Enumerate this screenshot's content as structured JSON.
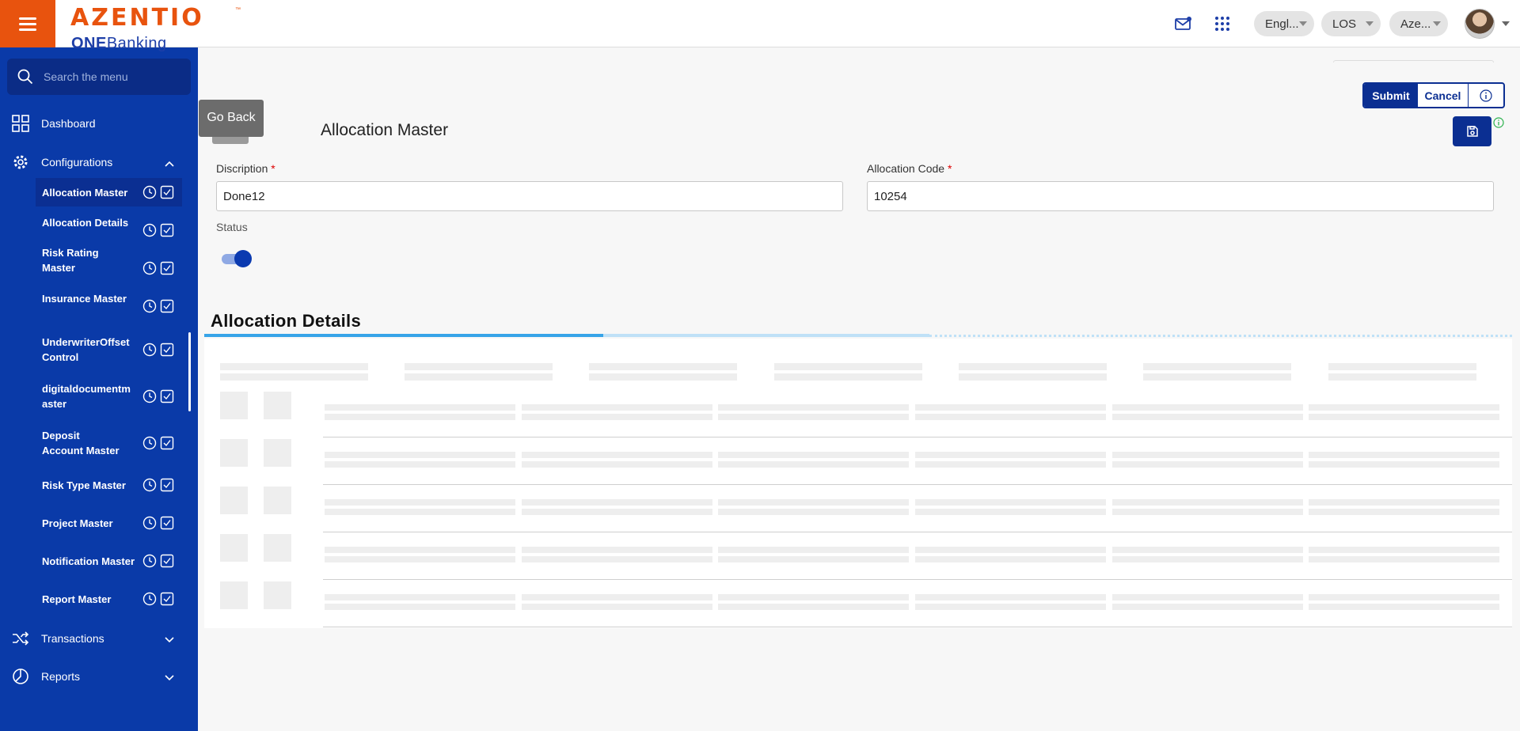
{
  "brand": {
    "name": "AZENTIO",
    "tm": "™",
    "sub_bold": "ONE",
    "sub_rest": "Banking"
  },
  "header": {
    "language": "Engl...",
    "module": "LOS",
    "entity": "Aze..."
  },
  "sidebar": {
    "search_placeholder": "Search the menu",
    "dashboard": "Dashboard",
    "configurations": "Configurations",
    "items": [
      {
        "label": "Allocation Master"
      },
      {
        "label": "Allocation Details"
      },
      {
        "label": "Risk Rating Master"
      },
      {
        "label": "Insurance Master"
      },
      {
        "label": "UnderwriterOffsetControl"
      },
      {
        "label": "digitaldocumentmaster"
      },
      {
        "label": "Deposit Account Master"
      },
      {
        "label": "Risk Type Master"
      },
      {
        "label": "Project Master"
      },
      {
        "label": "Notification Master"
      },
      {
        "label": "Report Master"
      }
    ],
    "transactions": "Transactions",
    "reports": "Reports"
  },
  "page": {
    "go_back": "Go Back",
    "title": "Allocation Master",
    "submit": "Submit",
    "cancel": "Cancel"
  },
  "form": {
    "description_label": "Discription",
    "description_value": "Done12",
    "code_label": "Allocation Code",
    "code_value": "10254",
    "required_mark": "*",
    "status_label": "Status",
    "status_on": true
  },
  "details": {
    "title": "Allocation Details",
    "loading_progress": 0.55
  },
  "colors": {
    "sidebar_bg": "#0a3aa8",
    "brand_orange": "#e8530e",
    "primary": "#0b2f92",
    "progress": "#37a4e8"
  }
}
